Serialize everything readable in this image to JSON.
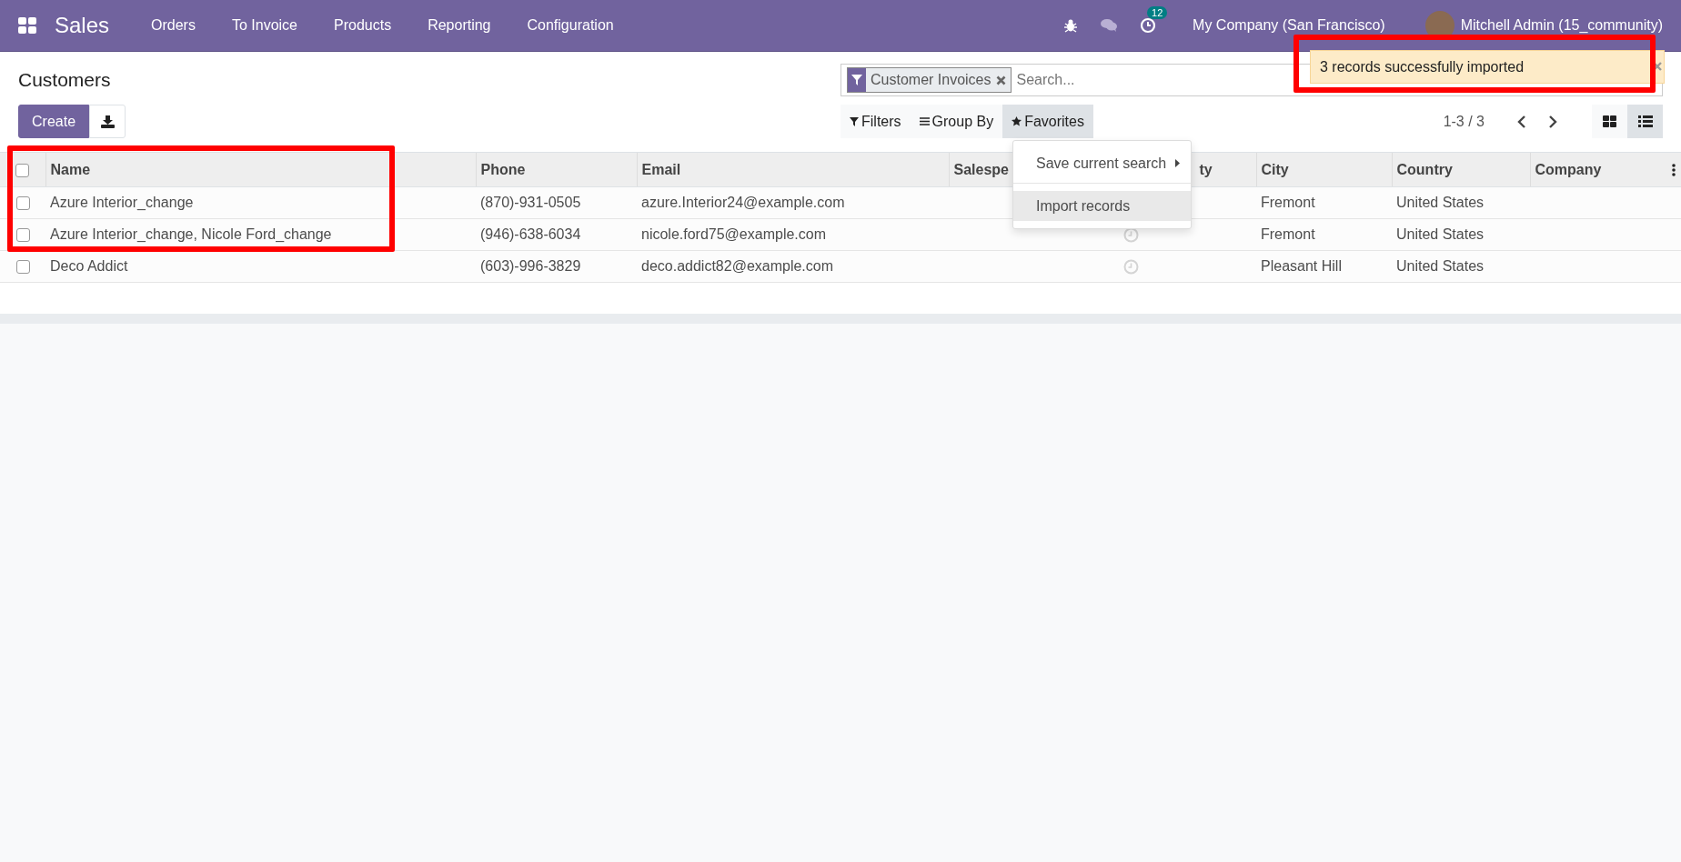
{
  "topbar": {
    "app_name": "Sales",
    "menu": [
      "Orders",
      "To Invoice",
      "Products",
      "Reporting",
      "Configuration"
    ],
    "activity_count": "12",
    "company": "My Company (San Francisco)",
    "user": "Mitchell Admin (15_community)"
  },
  "notification": {
    "message": "3 records successfully imported"
  },
  "breadcrumb": "Customers",
  "create_button": "Create",
  "search": {
    "facets": [
      {
        "label": "Customer Invoices"
      }
    ],
    "placeholder": "Search..."
  },
  "filter_buttons": [
    {
      "label": "Filters",
      "kind": "filter",
      "selected": false
    },
    {
      "label": "Group By",
      "kind": "group",
      "selected": false
    },
    {
      "label": "Favorites",
      "kind": "star",
      "selected": true
    }
  ],
  "favorites_menu": [
    {
      "label": "Save current search",
      "kind": "submenu",
      "selected": false
    },
    {
      "label": "Import records",
      "kind": "action",
      "selected": true
    }
  ],
  "pager": "1-3 / 3",
  "views": [
    {
      "kind": "kanban",
      "selected": false
    },
    {
      "kind": "list",
      "selected": true
    }
  ],
  "table": {
    "all_checked": false,
    "columns": [
      "Name",
      "Phone",
      "Email",
      "Salespe",
      "ty",
      "City",
      "Country",
      "Company"
    ],
    "rows": [
      {
        "checked": false,
        "name": "Azure Interior_change",
        "phone": "(870)-931-0505",
        "email": "azure.Interior24@example.com",
        "city": "Fremont",
        "country": "United States"
      },
      {
        "checked": false,
        "name": "Azure Interior_change, Nicole Ford_change",
        "phone": "(946)-638-6034",
        "email": "nicole.ford75@example.com",
        "activity_icon": true,
        "city": "Fremont",
        "country": "United States"
      },
      {
        "checked": false,
        "name": "Deco Addict",
        "phone": "(603)-996-3829",
        "email": "deco.addict82@example.com",
        "activity_icon": true,
        "city": "Pleasant Hill",
        "country": "United States"
      }
    ]
  }
}
